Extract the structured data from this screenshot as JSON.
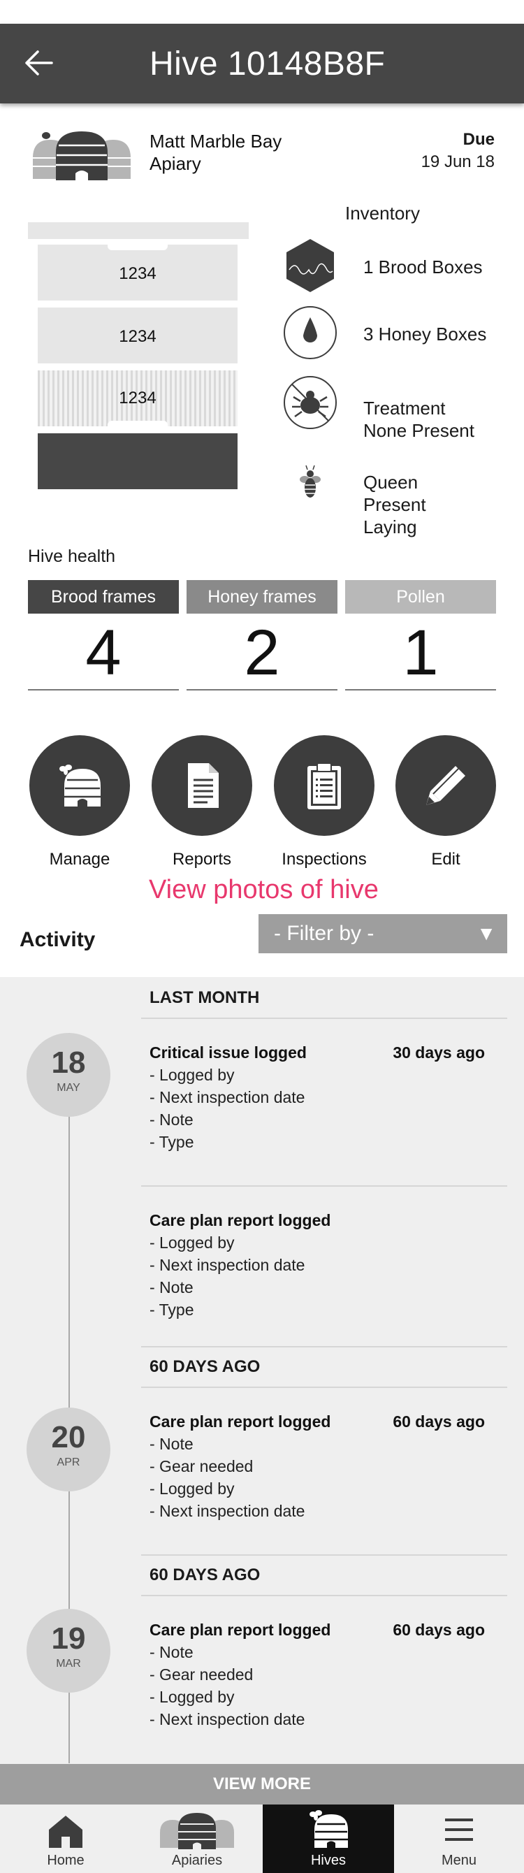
{
  "header": {
    "title": "Hive 10148B8F",
    "back_icon": "arrow-left-icon"
  },
  "apiary": {
    "name_line1": "Matt Marble Bay",
    "name_line2": "Apiary",
    "due_label": "Due",
    "due_date": "19 Jun 18"
  },
  "hive_boxes": [
    "1234",
    "1234",
    "1234"
  ],
  "inventory": {
    "title": "Inventory",
    "brood": "1 Brood Boxes",
    "honey": "3 Honey Boxes",
    "treatment_line1": "Treatment",
    "treatment_line2": "None Present",
    "queen_line1": "Queen",
    "queen_line2": "Present",
    "queen_line3": "Laying"
  },
  "health": {
    "title": "Hive health",
    "columns": [
      {
        "label": "Brood frames",
        "value": "4",
        "color": "#464646"
      },
      {
        "label": "Honey frames",
        "value": "2",
        "color": "#8a8a8a"
      },
      {
        "label": "Pollen",
        "value": "1",
        "color": "#b8b8b8"
      }
    ]
  },
  "actions": {
    "manage": "Manage",
    "reports": "Reports",
    "inspections": "Inspections",
    "edit": "Edit"
  },
  "photos_link": "View photos of hive",
  "activity": {
    "title": "Activity",
    "filter_label": "- Filter by  -",
    "filter_caret": "▼",
    "sections": [
      {
        "header": "LAST MONTH",
        "day": "18",
        "month": "MAY",
        "entries": [
          {
            "title": "Critical issue logged",
            "ago": "30 days ago",
            "lines": [
              "- Logged by",
              "- Next inspection date",
              "- Note",
              "- Type"
            ]
          },
          {
            "title": "Care plan report logged",
            "ago": "",
            "lines": [
              "- Logged by",
              "- Next inspection date",
              "- Note",
              "- Type"
            ]
          }
        ]
      },
      {
        "header": "60 DAYS AGO",
        "day": "20",
        "month": "APR",
        "entries": [
          {
            "title": "Care plan report logged",
            "ago": "60 days ago",
            "lines": [
              "- Note",
              "- Gear needed",
              "- Logged by",
              "- Next inspection date"
            ]
          }
        ]
      },
      {
        "header": "60 DAYS AGO",
        "day": "19",
        "month": "MAR",
        "entries": [
          {
            "title": "Care plan report logged",
            "ago": "60 days ago",
            "lines": [
              "- Note",
              "- Gear needed",
              "- Logged by",
              "- Next inspection date"
            ]
          }
        ]
      }
    ],
    "view_more": "VIEW MORE"
  },
  "nav": {
    "home": "Home",
    "apiaries": "Apiaries",
    "hives": "Hives",
    "menu": "Menu",
    "active": "Hives"
  },
  "colors": {
    "appbar": "#464646",
    "accent_link": "#e8386d",
    "feed_bg": "#efefef"
  }
}
